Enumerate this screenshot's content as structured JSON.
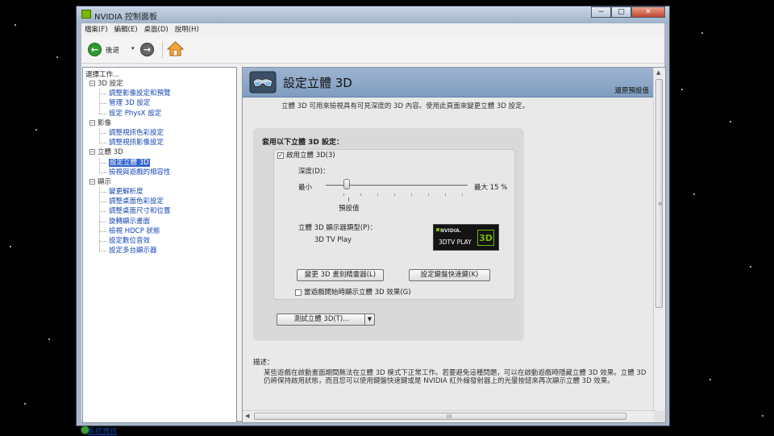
{
  "window": {
    "title": "NVIDIA 控制面板",
    "btn_min": "−",
    "btn_max": "□",
    "btn_close": "✕"
  },
  "menu": [
    "檔案(F)",
    "編輯(E)",
    "桌面(D)",
    "說明(H)"
  ],
  "toolbar": {
    "back_label": "後退",
    "dropdown_glyph": "▾"
  },
  "tree": {
    "heading": "選擇工作...",
    "categories": [
      {
        "label": "3D 設定",
        "toggle": "−",
        "items": [
          {
            "label": "調整影像設定和預覽"
          },
          {
            "label": "管理 3D 設定"
          },
          {
            "label": "設定 PhysX 設定"
          }
        ]
      },
      {
        "label": "影像",
        "toggle": "−",
        "items": [
          {
            "label": "調整視訊色彩設定"
          },
          {
            "label": "調整視訊影像設定"
          }
        ]
      },
      {
        "label": "立體 3D",
        "toggle": "−",
        "items": [
          {
            "label": "設定立體 3D",
            "selected": true
          },
          {
            "label": "檢視與遊戲的相容性"
          }
        ]
      },
      {
        "label": "顯示",
        "toggle": "−",
        "items": [
          {
            "label": "變更解析度"
          },
          {
            "label": "調整桌面色彩設定"
          },
          {
            "label": "調整桌面尺寸和位置"
          },
          {
            "label": "旋轉顯示畫面"
          },
          {
            "label": "檢視 HDCP 狀態"
          },
          {
            "label": "設定數位音效"
          },
          {
            "label": "設定多台顯示器"
          }
        ]
      }
    ],
    "system_info": "系統資訊"
  },
  "main": {
    "title": "設定立體 3D",
    "restore_defaults": "還原預設值",
    "subtitle": "立體 3D 可用來檢視具有可見深度的 3D 內容。使用此頁面來變更立體 3D 設定。",
    "section_title": "套用以下立體 3D 設定：",
    "enable_checkbox": {
      "label": "啟用立體 3D(3)",
      "checked": true,
      "mark": "✓"
    },
    "depth": {
      "label": "深度(D)：",
      "min_label": "最小",
      "max_label": "最大  15  %",
      "default_label": "預設值",
      "value_percent": 15
    },
    "display_type": {
      "label": "立體 3D 顯示器類型(P)：",
      "value": "3D TV Play"
    },
    "logo": {
      "brand": "NVIDIA.",
      "product": "3DTV PLAY",
      "badge": "3D"
    },
    "buttons": {
      "wizard": "變更 3D 畫刻精靈器(L)",
      "hotkeys": "設定鍵盤快速鍵(K)"
    },
    "notify_checkbox": {
      "label": "當遊戲開始時顯示立體 3D 效果(G)",
      "checked": false
    },
    "test_dropdown": {
      "label": "測試立體 3D(T)...",
      "arrow": "▼"
    },
    "description_label": "描述：",
    "description": "某些遊戲在啟動畫面期間無法在立體 3D 模式下正常工作。若要避免這種問題，可以在啟動遊戲時隱藏立體 3D 效果。立體 3D 仍將保持啟用狀態，而且您可以使用鍵盤快速鍵或是 NVIDIA 紅外線發射器上的光暈按鈕來再次顯示立體 3D 效果。"
  },
  "scroll": {
    "up": "▲",
    "down": "▼",
    "left": "◀",
    "right": "▶",
    "grip_v": "≡",
    "grip_h": "III"
  },
  "colors": {
    "nvidia_green": "#76b900",
    "banner_blue": "#8aa6c8",
    "link_blue": "#1646b4",
    "selection": "#3366cc"
  }
}
